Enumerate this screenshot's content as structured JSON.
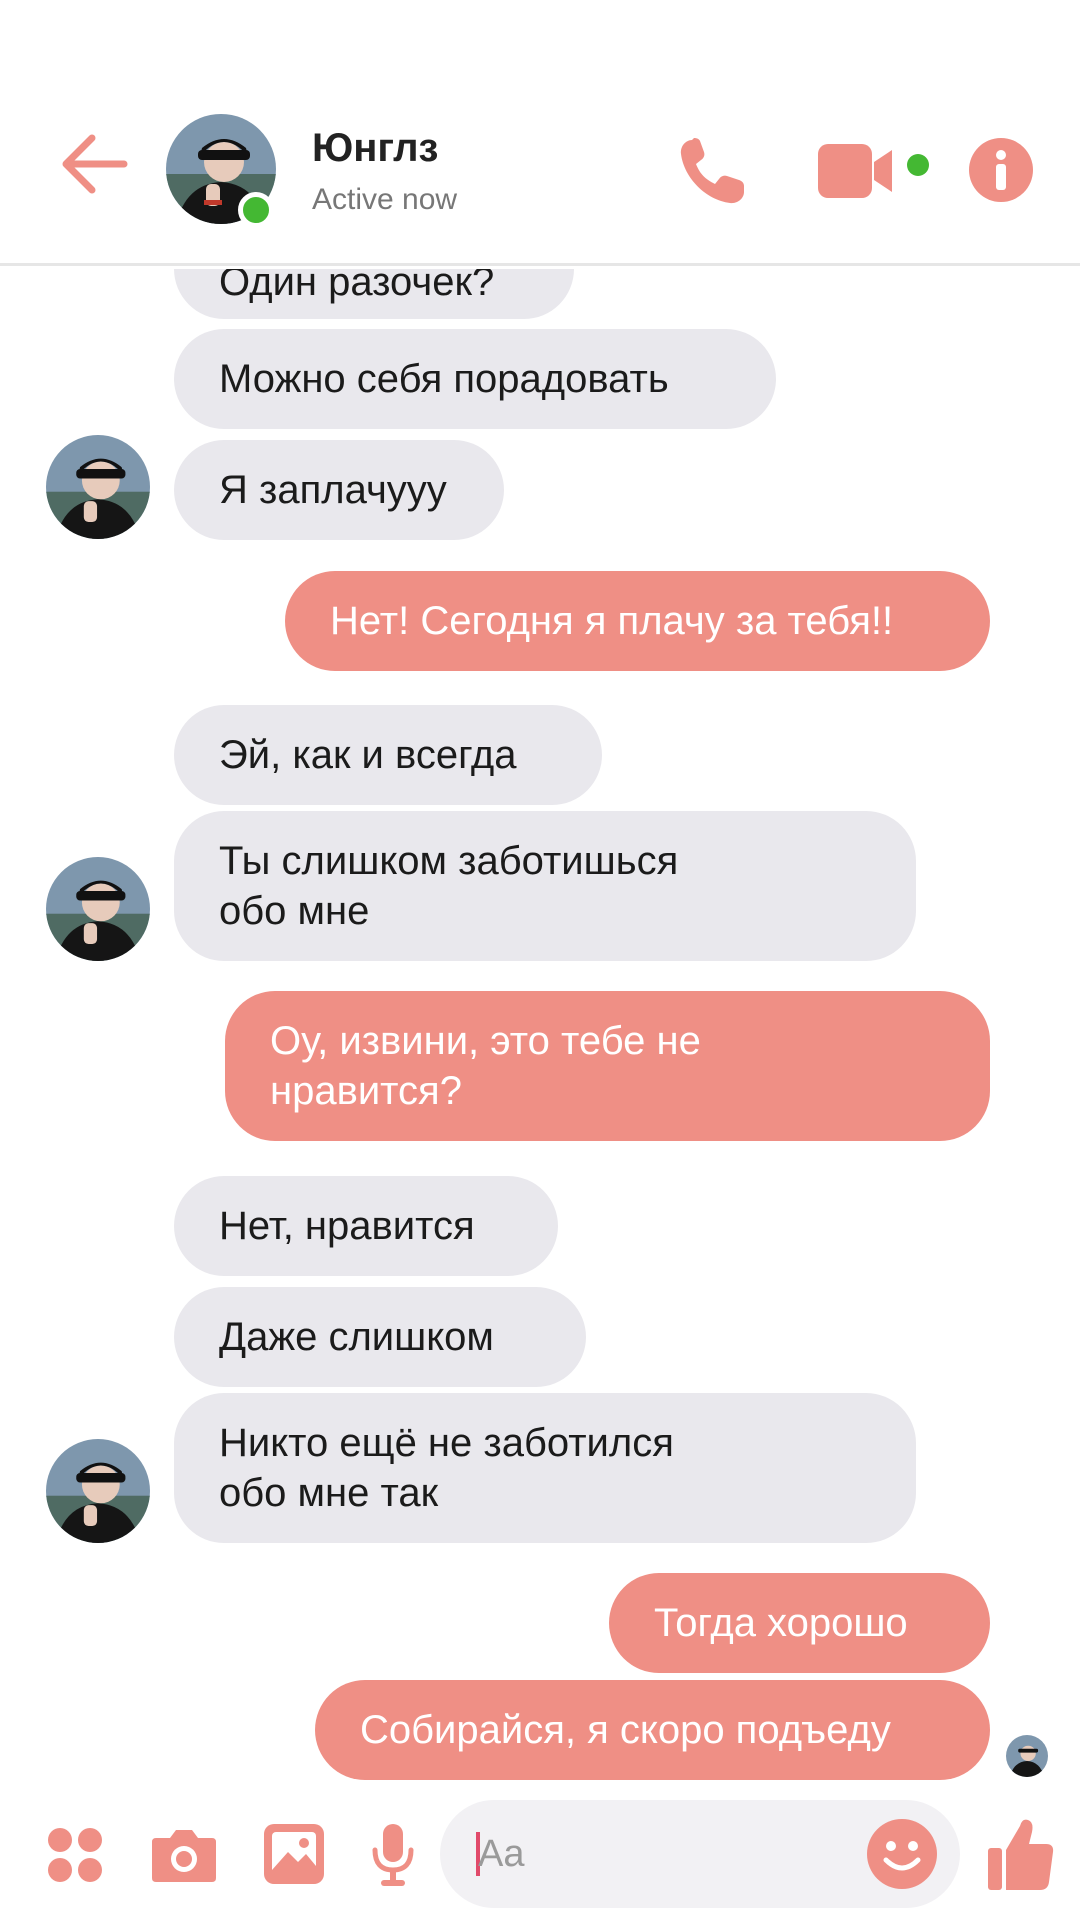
{
  "header": {
    "contact_name": "Юнглз",
    "status": "Active now",
    "icons": [
      "back-arrow-icon",
      "phone-icon",
      "video-camera-icon",
      "info-icon"
    ]
  },
  "colors": {
    "accent": "#ef8f85",
    "incoming_bubble": "#e9e8ed",
    "online": "#44b833"
  },
  "messages": [
    {
      "from": "them",
      "text": "Один разочек?"
    },
    {
      "from": "them",
      "text": "Можно себя порадовать"
    },
    {
      "from": "them",
      "text": "Я заплачууу"
    },
    {
      "from": "me",
      "text": "Нет! Сегодня я плачу за тебя!!"
    },
    {
      "from": "them",
      "text": "Эй, как и всегда"
    },
    {
      "from": "them",
      "line1": "Ты слишком заботишься",
      "line2": "обо мне"
    },
    {
      "from": "me",
      "line1": "Оу, извини, это тебе не",
      "line2": "нравится?"
    },
    {
      "from": "them",
      "text": "Нет, нравится"
    },
    {
      "from": "them",
      "text": "Даже слишком"
    },
    {
      "from": "them",
      "line1": "Никто ещё не заботился",
      "line2": "обо мне так"
    },
    {
      "from": "me",
      "text": "Тогда хорошо"
    },
    {
      "from": "me",
      "text": "Собирайся, я скоро подъеду"
    }
  ],
  "composer": {
    "placeholder": "Aa",
    "icons": [
      "apps-grid-icon",
      "camera-icon",
      "gallery-icon",
      "microphone-icon",
      "emoji-icon",
      "thumbs-up-icon"
    ]
  }
}
